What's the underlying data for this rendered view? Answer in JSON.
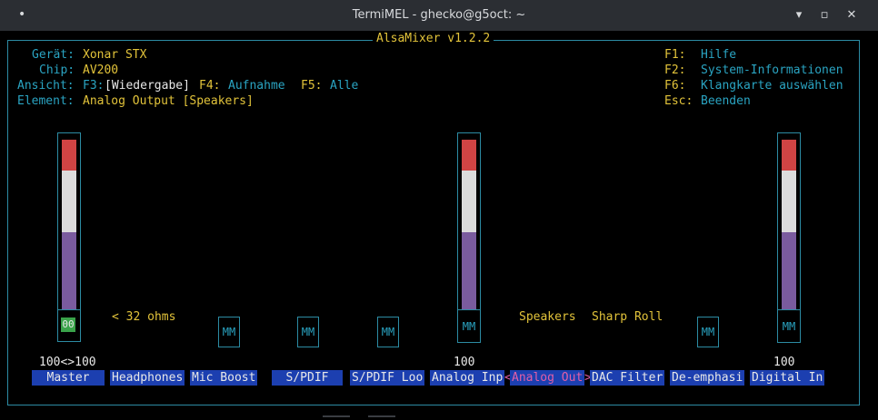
{
  "window": {
    "title": "TermiMEL - ghecko@g5oct: ~",
    "minimize": "▾",
    "maximize": "▫",
    "close": "✕"
  },
  "app": {
    "title": "AlsaMixer v1.2.2"
  },
  "info": {
    "device_label": "Gerät:",
    "device_value": "Xonar STX",
    "chip_label": "Chip:",
    "chip_value": "AV200",
    "view_label": "Ansicht:",
    "view_f3": "F3:",
    "view_f3_value": "[Wiedergabe]",
    "view_f4": "F4:",
    "view_f4_value": "Aufnahme",
    "view_f5": "F5:",
    "view_f5_value": "Alle",
    "element_label": "Element:",
    "element_value": "Analog Output [Speakers]"
  },
  "help": [
    {
      "key": "F1:",
      "text": "Hilfe"
    },
    {
      "key": "F2:",
      "text": "System-Informationen"
    },
    {
      "key": "F6:",
      "text": "Klangkarte auswählen"
    },
    {
      "key": "Esc:",
      "text": "Beenden"
    }
  ],
  "controls": {
    "master_mute": "00",
    "master_value": "100<>100",
    "headphones_value": "< 32 ohms",
    "mm": "MM",
    "analog_input_value": "100",
    "analog_output_value": "Speakers",
    "dac_filter_value": "Sharp Roll",
    "digital_input_value": "100",
    "names": [
      "Master",
      "Headphones",
      "Mic Boost",
      "S/PDIF",
      "S/PDIF Loo",
      "Analog Inp",
      "Analog Out",
      "DAC Filter",
      "De-emphasi",
      "Digital In"
    ],
    "selected_left_bracket": "<",
    "selected_right_bracket": ">"
  },
  "colors": {
    "frame": "#2c8ba3",
    "label": "#2aa4c2",
    "value": "#e2c33a",
    "selected": "#e25fa6",
    "control_bg": "#1c3fb0"
  }
}
